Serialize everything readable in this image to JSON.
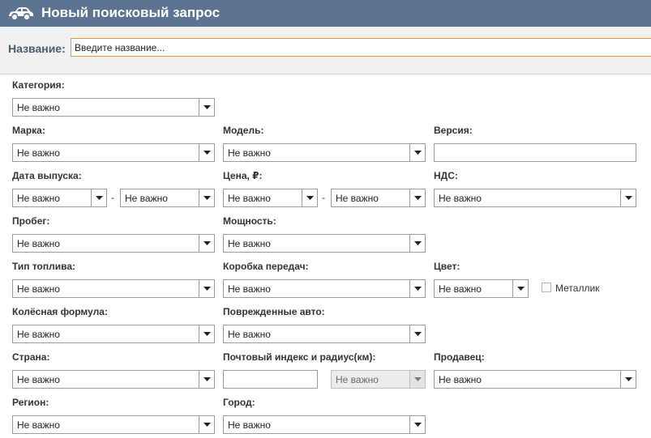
{
  "header": {
    "title": "Новый поисковый запрос",
    "icon": "car-icon",
    "bg": "#5c7491"
  },
  "name_row": {
    "label": "Название:",
    "placeholder": "Введите название..."
  },
  "fields": {
    "category": {
      "label": "Категория:",
      "value": "Не важно"
    },
    "make": {
      "label": "Марка:",
      "value": "Не важно"
    },
    "model": {
      "label": "Модель:",
      "value": "Не важно"
    },
    "version": {
      "label": "Версия:",
      "value": ""
    },
    "reg_date": {
      "label": "Дата выпуска:",
      "from": "Не важно",
      "sep": "-",
      "to": "Не важно"
    },
    "price": {
      "label": "Цена, ₽:",
      "from": "Не важно",
      "sep": "-",
      "to": "Не важно"
    },
    "vat": {
      "label": "НДС:",
      "value": "Не важно"
    },
    "mileage": {
      "label": "Пробег:",
      "value": "Не важно"
    },
    "power": {
      "label": "Мощность:",
      "value": "Не важно"
    },
    "fuel": {
      "label": "Тип топлива:",
      "value": "Не важно"
    },
    "gearbox": {
      "label": "Коробка передач:",
      "value": "Не важно"
    },
    "color": {
      "label": "Цвет:",
      "value": "Не важно",
      "metallic_label": "Металлик",
      "metallic_checked": false
    },
    "wheel_formula": {
      "label": "Колёсная формула:",
      "value": "Не важно"
    },
    "damaged": {
      "label": "Поврежденные авто:",
      "value": "Не важно"
    },
    "country": {
      "label": "Страна:",
      "value": "Не важно"
    },
    "postal": {
      "label": "Почтовый индекс и радиус(км):",
      "zip": "",
      "radius": "Не важно"
    },
    "seller": {
      "label": "Продавец:",
      "value": "Не важно"
    },
    "region": {
      "label": "Регион:",
      "value": "Не важно"
    },
    "city": {
      "label": "Город:",
      "value": "Не важно"
    }
  }
}
